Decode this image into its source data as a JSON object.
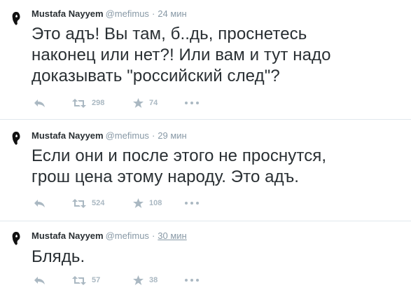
{
  "tweets": [
    {
      "name": "Mustafa Nayyem",
      "handle": "@mefimus",
      "separator": "·",
      "time": "24 мин",
      "lines": [
        "Это адъ! Вы там, б..дь, проснетесь",
        "наконец или нет?! Или вам и тут надо",
        "доказывать \"российский след\"?"
      ],
      "retweets": "298",
      "favorites": "74"
    },
    {
      "name": "Mustafa Nayyem",
      "handle": "@mefimus",
      "separator": "·",
      "time": "29 мин",
      "lines": [
        "Если они и после этого не проснутся,",
        "грош цена этому народу. Это адъ."
      ],
      "retweets": "524",
      "favorites": "108"
    },
    {
      "name": "Mustafa Nayyem",
      "handle": "@mefimus",
      "separator": "·",
      "time": "30 мин",
      "lines": [
        "Блядь."
      ],
      "retweets": "57",
      "favorites": "38"
    }
  ],
  "icons": {
    "reply": "reply-arrow-icon",
    "retweet": "retweet-icon",
    "favorite": "star-icon",
    "more": "more-dots-icon"
  },
  "colors": {
    "text": "#292f33",
    "meta": "#8899a6",
    "action": "#aab8c2",
    "divider": "#e1e8ed"
  }
}
